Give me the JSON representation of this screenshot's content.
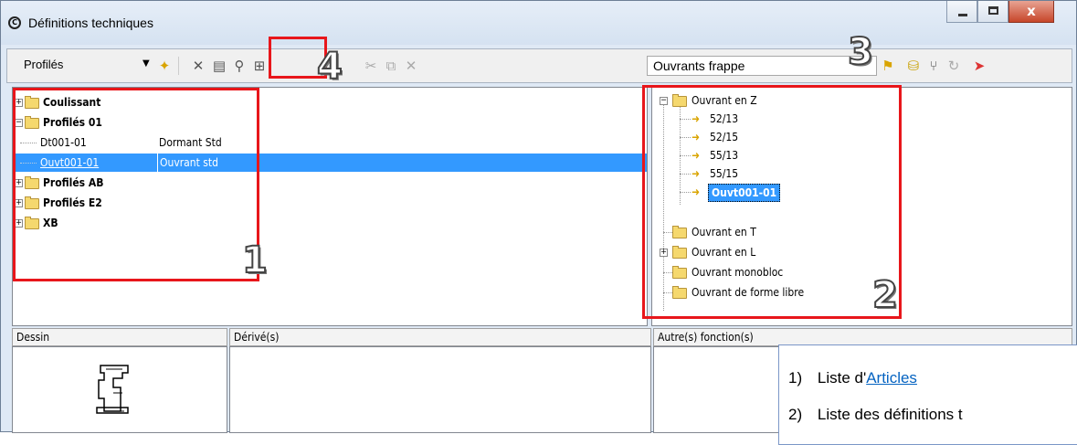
{
  "window": {
    "title": "Définitions techniques",
    "close_glyph": "x"
  },
  "toolbar": {
    "left_combo": "Profilés",
    "right_combo": "Ouvrants frappe"
  },
  "left_tree": {
    "items": [
      {
        "label": "Coulissant",
        "desc": "",
        "bold": true,
        "folder": true
      },
      {
        "label": "Profilés 01",
        "desc": "",
        "bold": true,
        "folder": true
      },
      {
        "label": "Dt001-01",
        "desc": "Dormant Std",
        "bold": false,
        "folder": false
      },
      {
        "label": "Ouvt001-01",
        "desc": "Ouvrant std",
        "bold": false,
        "folder": false,
        "selected": true
      },
      {
        "label": "Profilés AB",
        "desc": "",
        "bold": true,
        "folder": true
      },
      {
        "label": "Profilés E2",
        "desc": "",
        "bold": true,
        "folder": true
      },
      {
        "label": "XB",
        "desc": "",
        "bold": true,
        "folder": true
      }
    ]
  },
  "right_tree": {
    "items": [
      {
        "label": "Ouvrant en Z"
      },
      {
        "label": "52/13"
      },
      {
        "label": "52/15"
      },
      {
        "label": "55/13"
      },
      {
        "label": "55/15"
      },
      {
        "label": "Ouvt001-01"
      },
      {
        "label": "Ouvrant en T"
      },
      {
        "label": "Ouvrant en L"
      },
      {
        "label": "Ouvrant monobloc"
      },
      {
        "label": "Ouvrant de forme libre"
      }
    ]
  },
  "bottom": {
    "col1": "Dessin",
    "col2": "Dérivé(s)",
    "col3": "Autre(s) fonction(s)"
  },
  "callouts": {
    "n1": "1",
    "n2": "2",
    "n3": "3",
    "n4": "4"
  },
  "legend": {
    "item1_num": "1)",
    "item1_text": "Liste d'",
    "item1_link": "Articles",
    "item2_num": "2)",
    "item2_text": "Liste des définitions t"
  },
  "colors": {
    "selection": "#3399ff",
    "callout_red": "#e8161b"
  }
}
